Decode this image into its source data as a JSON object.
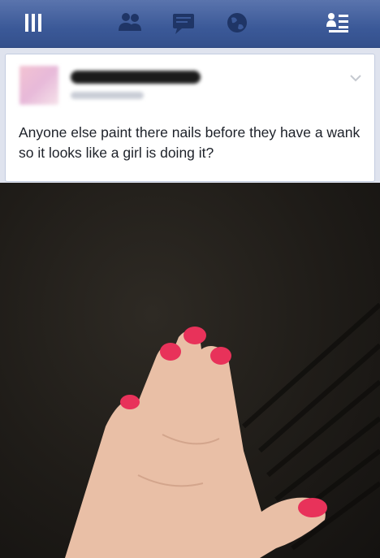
{
  "navbar": {
    "icons": [
      {
        "name": "menu-icon"
      },
      {
        "name": "friend-requests-icon"
      },
      {
        "name": "messages-icon"
      },
      {
        "name": "notifications-globe-icon"
      },
      {
        "name": "chat-list-icon"
      }
    ]
  },
  "post": {
    "text": "Anyone else paint there nails before they have a wank so it looks like a girl is doing it?"
  },
  "colors": {
    "brand": "#3b5998",
    "nail_polish": "#e8325a",
    "background": "#dfe3ee"
  }
}
